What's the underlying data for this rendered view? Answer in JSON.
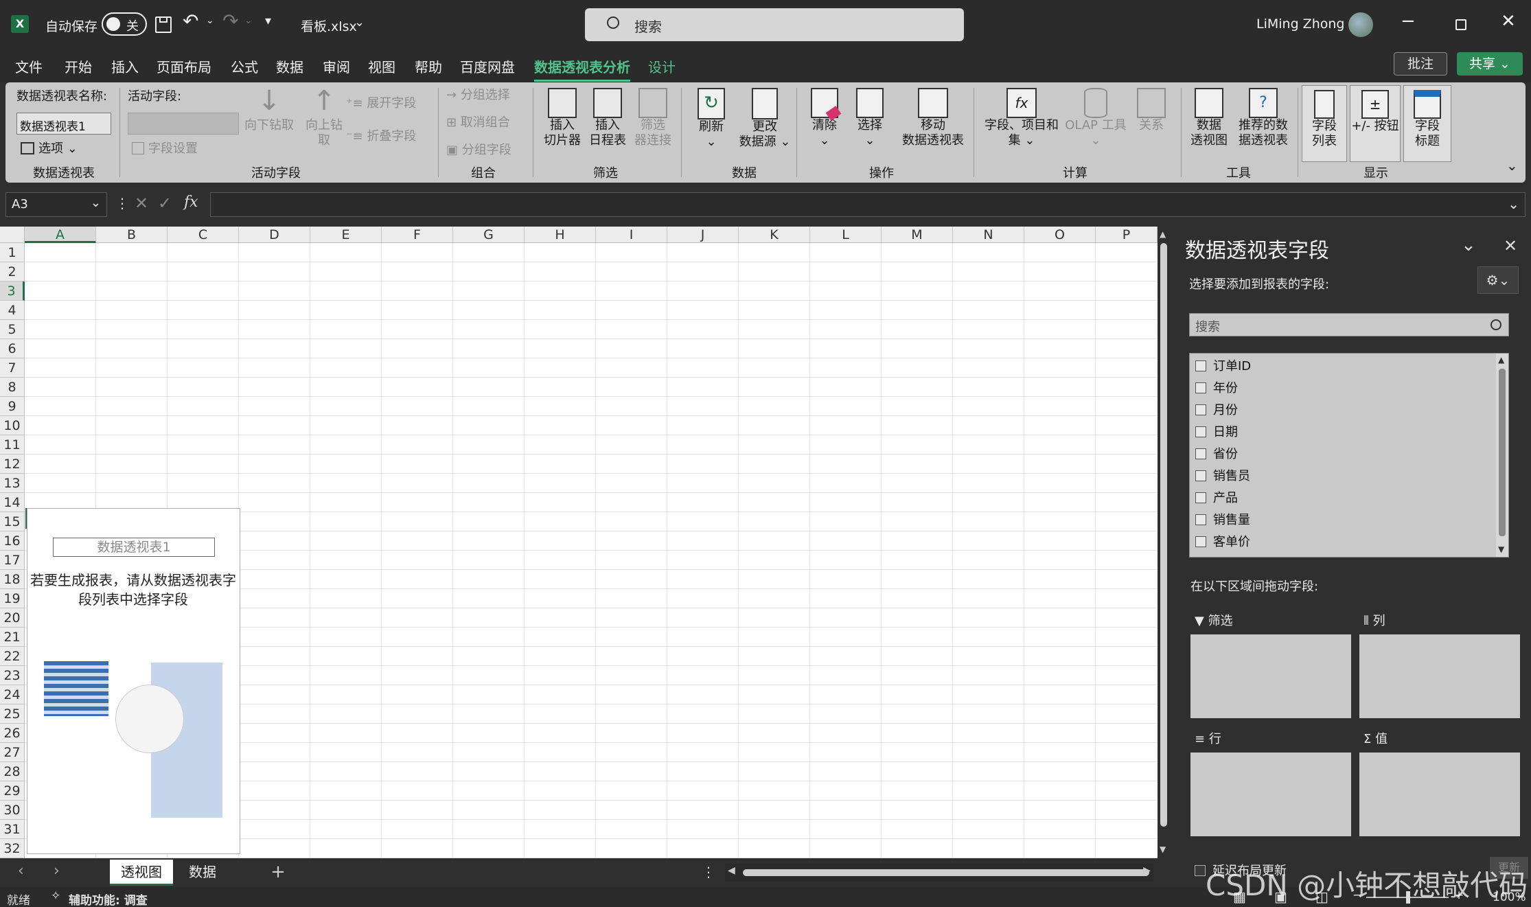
{
  "titlebar": {
    "autosave_label": "自动保存",
    "autosave_state": "关",
    "filename": "看板.xlsx",
    "search_placeholder": "搜索",
    "user_name": "LiMing Zhong"
  },
  "menu_tabs": [
    "文件",
    "开始",
    "插入",
    "页面布局",
    "公式",
    "数据",
    "审阅",
    "视图",
    "帮助",
    "百度网盘",
    "数据透视表分析",
    "设计"
  ],
  "comments_label": "批注",
  "share_label": "共享",
  "ribbon": {
    "pt_name_label": "数据透视表名称:",
    "pt_name_value": "数据透视表1",
    "options_label": "选项",
    "group_pivottable": "数据透视表",
    "active_field_label": "活动字段:",
    "drill_down": "向下钻取",
    "drill_up_1": "向上钻",
    "drill_up_2": "取",
    "expand_field": "展开字段",
    "collapse_field": "折叠字段",
    "field_settings": "字段设置",
    "group_active_field": "活动字段",
    "group_selection": "分组选择",
    "ungroup": "取消组合",
    "group_field": "分组字段",
    "group_group": "组合",
    "insert_slicer_1": "插入",
    "insert_slicer_2": "切片器",
    "insert_timeline_1": "插入",
    "insert_timeline_2": "日程表",
    "filter_conn_1": "筛选",
    "filter_conn_2": "器连接",
    "group_filter": "筛选",
    "refresh": "刷新",
    "change_source_1": "更改",
    "change_source_2": "数据源",
    "group_data": "数据",
    "clear": "清除",
    "select": "选择",
    "move_pt_1": "移动",
    "move_pt_2": "数据透视表",
    "group_actions": "操作",
    "fields_items_1": "字段、项目和",
    "fields_items_2": "集",
    "olap_1": "OLAP 工具",
    "relations": "关系",
    "group_calc": "计算",
    "pivotchart_1": "数据",
    "pivotchart_2": "透视图",
    "recommended_1": "推荐的数",
    "recommended_2": "据透视表",
    "group_tools": "工具",
    "field_list_1": "字段",
    "field_list_2": "列表",
    "buttons": "+/- 按钮",
    "field_headers_1": "字段",
    "field_headers_2": "标题",
    "group_show": "显示"
  },
  "formula": {
    "namebox": "A3",
    "fx": "fx"
  },
  "columns": [
    "A",
    "B",
    "C",
    "D",
    "E",
    "F",
    "G",
    "H",
    "I",
    "J",
    "K",
    "L",
    "M",
    "N",
    "O",
    "P"
  ],
  "rows": [
    "1",
    "2",
    "3",
    "4",
    "5",
    "6",
    "7",
    "8",
    "9",
    "10",
    "11",
    "12",
    "13",
    "14",
    "15",
    "16",
    "17",
    "18",
    "19",
    "20",
    "21",
    "22",
    "23",
    "24",
    "25",
    "26",
    "27",
    "28",
    "29",
    "30",
    "31",
    "32"
  ],
  "placeholder": {
    "name": "数据透视表1",
    "message": "若要生成报表，请从数据透视表字段列表中选择字段"
  },
  "sheets": {
    "tab1": "透视图",
    "tab2": "数据",
    "add": "+"
  },
  "status": {
    "ready": "就绪",
    "accessibility": "辅助功能: 调查",
    "zoom": "100%"
  },
  "pane": {
    "title": "数据透视表字段",
    "choose_label": "选择要添加到报表的字段:",
    "search_placeholder": "搜索",
    "fields": [
      "订单ID",
      "年份",
      "月份",
      "日期",
      "省份",
      "销售员",
      "产品",
      "销售量",
      "客单价"
    ],
    "drag_label": "在以下区域间拖动字段:",
    "area_filter": "筛选",
    "area_columns": "列",
    "area_rows": "行",
    "area_values": "值",
    "defer_label": "延迟布局更新",
    "update_label": "更新"
  },
  "watermark": "CSDN @小钟不想敲代码",
  "colors": {
    "accent": "#4fc38a",
    "excel_green": "#1e7145"
  }
}
